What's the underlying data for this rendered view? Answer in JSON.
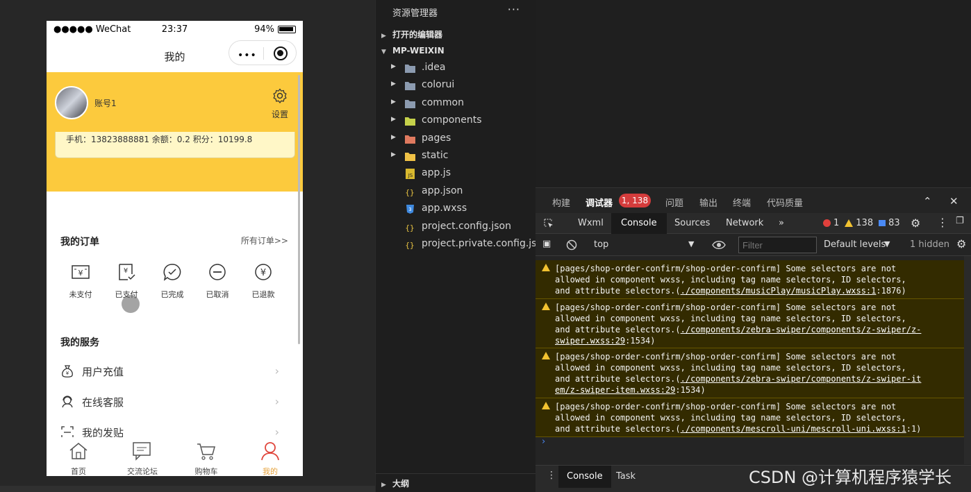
{
  "phone": {
    "status": {
      "carrier": "●●●●● WeChat",
      "time": "23:37",
      "battery": "94%"
    },
    "nav_title": "我的",
    "capsule_dots": "•••",
    "profile": {
      "username": "账号1",
      "settings_label": "设置",
      "info": "手机：13823888881   余额：0.2   积分：10199.8"
    },
    "orders": {
      "title": "我的订单",
      "all_link": "所有订单>>",
      "items": [
        {
          "label": "未支付",
          "icon": "unpaid-icon"
        },
        {
          "label": "已支付",
          "icon": "paid-icon"
        },
        {
          "label": "已完成",
          "icon": "completed-icon"
        },
        {
          "label": "已取消",
          "icon": "cancelled-icon"
        },
        {
          "label": "已退款",
          "icon": "refunded-icon"
        }
      ]
    },
    "services": {
      "title": "我的服务",
      "items": [
        {
          "label": "用户充值",
          "icon": "money-bag-icon"
        },
        {
          "label": "在线客服",
          "icon": "customer-service-icon"
        },
        {
          "label": "我的发贴",
          "icon": "scan-icon"
        }
      ]
    },
    "tabbar": [
      {
        "label": "首页",
        "icon": "home-icon"
      },
      {
        "label": "交流论坛",
        "icon": "forum-icon"
      },
      {
        "label": "购物车",
        "icon": "cart-icon"
      },
      {
        "label": "我的",
        "icon": "user-icon",
        "active": true
      }
    ],
    "colors": {
      "profile_bg": "#fcca3d",
      "active_tab": "#e6a23c"
    }
  },
  "explorer": {
    "title": "资源管理器",
    "more": "···",
    "open_editors": "打开的编辑器",
    "project": "MP-WEIXIN",
    "items": [
      {
        "label": ".idea",
        "type": "folder",
        "icon": "folder-icon"
      },
      {
        "label": "colorui",
        "type": "folder",
        "icon": "folder-icon"
      },
      {
        "label": "common",
        "type": "folder",
        "icon": "folder-icon"
      },
      {
        "label": "components",
        "type": "folder",
        "icon": "components-folder-icon"
      },
      {
        "label": "pages",
        "type": "folder",
        "icon": "pages-folder-icon"
      },
      {
        "label": "static",
        "type": "folder",
        "icon": "static-folder-icon"
      },
      {
        "label": "app.js",
        "type": "file",
        "icon": "js-file-icon"
      },
      {
        "label": "app.json",
        "type": "file",
        "icon": "json-file-icon"
      },
      {
        "label": "app.wxss",
        "type": "file",
        "icon": "css-file-icon"
      },
      {
        "label": "project.config.json",
        "type": "file",
        "icon": "json-file-icon"
      },
      {
        "label": "project.private.config.js...",
        "type": "file",
        "icon": "json-file-icon"
      }
    ],
    "outline": "大纲"
  },
  "devtools": {
    "top_tabs": [
      "构建",
      "调试器",
      "问题",
      "输出",
      "终端",
      "代码质量"
    ],
    "badge": "1, 138",
    "console_tabs": [
      "Wxml",
      "Console",
      "Sources",
      "Network"
    ],
    "more_tabs": "»",
    "counts": {
      "errors": "1",
      "warnings": "138",
      "info": "83"
    },
    "context": "top",
    "filter_placeholder": "Filter",
    "levels": "Default levels",
    "hidden": "1 hidden",
    "logs": [
      {
        "lines": [
          "[pages/shop-order-confirm/shop-order-confirm] Some selectors are not",
          "allowed in component wxss, including tag name selectors, ID selectors,"
        ],
        "tail_prefix": "and attribute selectors.(",
        "links": [
          "./components/musicPlay/musicPlay.wxss:1"
        ],
        "tail_suffix": ":1876)"
      },
      {
        "lines": [
          "[pages/shop-order-confirm/shop-order-confirm] Some selectors are not",
          "allowed in component wxss, including tag name selectors, ID selectors,"
        ],
        "tail_prefix": "and attribute selectors.(",
        "links": [
          "./components/zebra-swiper/components/z-swiper/z-",
          "swiper.wxss:29"
        ],
        "tail_suffix": ":1534)"
      },
      {
        "lines": [
          "[pages/shop-order-confirm/shop-order-confirm] Some selectors are not",
          "allowed in component wxss, including tag name selectors, ID selectors,"
        ],
        "tail_prefix": "and attribute selectors.(",
        "links": [
          "./components/zebra-swiper/components/z-swiper-it",
          "em/z-swiper-item.wxss:29"
        ],
        "tail_suffix": ":1534)"
      },
      {
        "lines": [
          "[pages/shop-order-confirm/shop-order-confirm] Some selectors are not",
          "allowed in component wxss, including tag name selectors, ID selectors,"
        ],
        "tail_prefix": "and attribute selectors.(",
        "links": [
          "./components/mescroll-uni/mescroll-uni.wxss:1"
        ],
        "tail_suffix": ":1)"
      }
    ],
    "prompt": "›",
    "drawer_tabs": [
      "Console",
      "Task"
    ]
  },
  "watermark": "CSDN @计算机程序猿学长"
}
